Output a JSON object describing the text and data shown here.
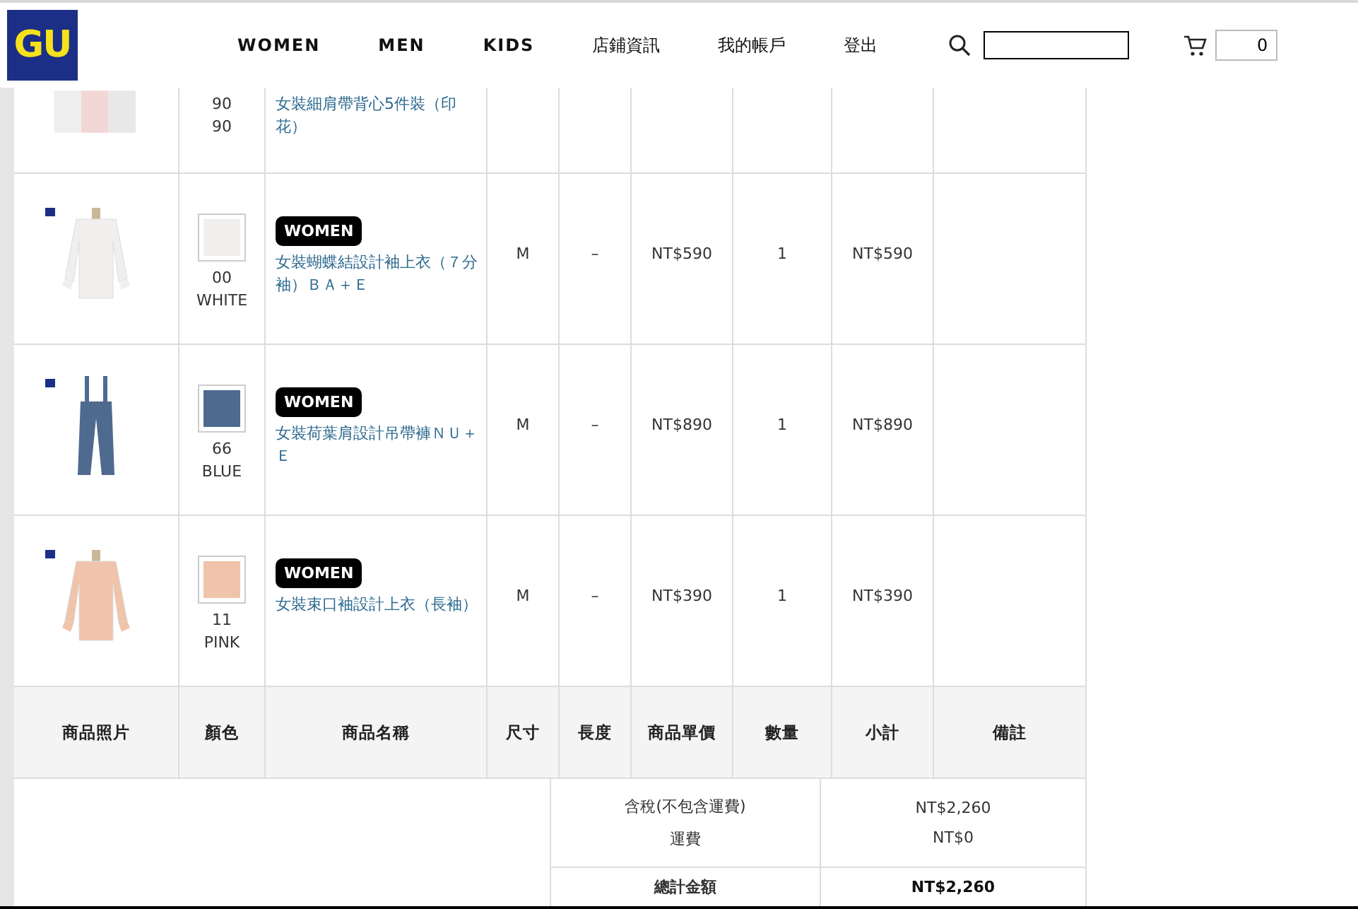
{
  "header": {
    "logo": "GU",
    "nav": [
      "WOMEN",
      "MEN",
      "KIDS",
      "店鋪資訊",
      "我的帳戶",
      "登出"
    ],
    "cart_count": "0"
  },
  "items": [
    {
      "kind": "partial",
      "color_code": "90",
      "color_name": "90",
      "name": "女裝細肩帶背心5件裝（印花）"
    },
    {
      "kind": "full",
      "color": "#f0efed",
      "color_code": "00",
      "color_name": "WHITE",
      "tag": "WOMEN",
      "name": "女裝蝴蝶結設計袖上衣（７分袖）ＢＡ＋Ｅ",
      "size": "M",
      "length": "–",
      "price": "NT$590",
      "qty": "1",
      "subtotal": "NT$590"
    },
    {
      "kind": "full",
      "color": "#4f6a8f",
      "color_code": "66",
      "color_name": "BLUE",
      "tag": "WOMEN",
      "name": "女裝荷葉肩設計吊帶褲ＮＵ＋Ｅ",
      "size": "M",
      "length": "–",
      "price": "NT$890",
      "qty": "1",
      "subtotal": "NT$890"
    },
    {
      "kind": "full",
      "color": "#efc4aa",
      "color_code": "11",
      "color_name": "PINK",
      "tag": "WOMEN",
      "name": "女裝束口袖設計上衣（長袖）",
      "size": "M",
      "length": "–",
      "price": "NT$390",
      "qty": "1",
      "subtotal": "NT$390"
    }
  ],
  "columns": [
    "商品照片",
    "顏色",
    "商品名稱",
    "尺寸",
    "長度",
    "商品單價",
    "數量",
    "小計",
    "備註"
  ],
  "summary": {
    "lines": [
      {
        "label": "含稅(不包含運費)",
        "value": "NT$2,260"
      },
      {
        "label": "運費",
        "value": "NT$0"
      }
    ],
    "total": {
      "label": "總計金額",
      "value": "NT$2,260"
    }
  }
}
